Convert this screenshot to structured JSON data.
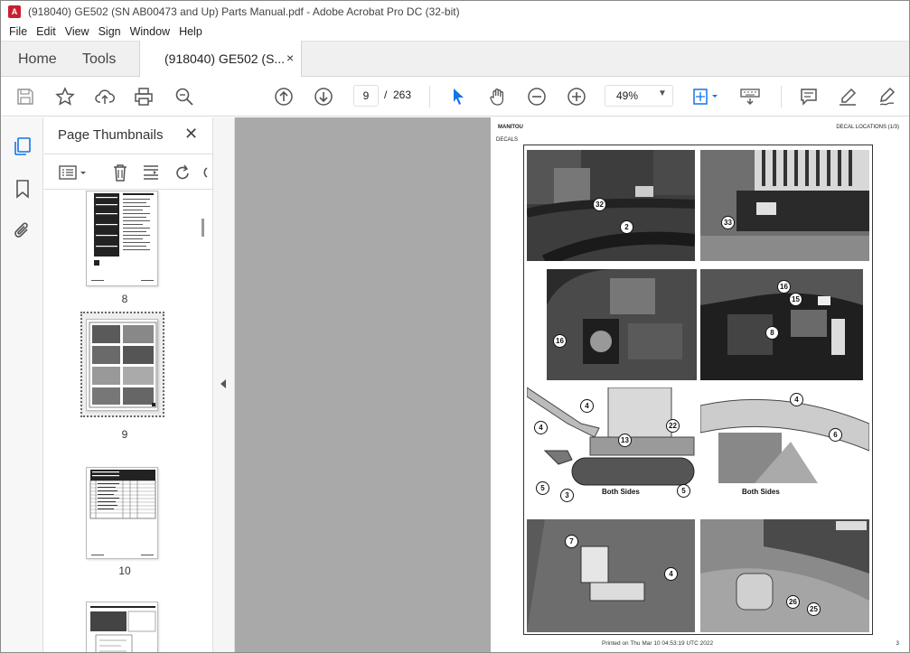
{
  "window": {
    "title": "(918040) GE502 (SN AB00473 and Up) Parts Manual.pdf - Adobe Acrobat Pro DC (32-bit)",
    "app_icon": "acrobat-icon",
    "app_icon_glyph": "A"
  },
  "menu": [
    "File",
    "Edit",
    "View",
    "Sign",
    "Window",
    "Help"
  ],
  "tabs": {
    "home": "Home",
    "tools": "Tools",
    "document": "(918040) GE502 (S...",
    "close": "×"
  },
  "toolbar": {
    "current_page": "9",
    "page_sep": "/",
    "total_pages": "263",
    "zoom": "49%",
    "zoom_caret": "▼"
  },
  "thumbnail_panel": {
    "title": "Page Thumbnails",
    "close": "✕",
    "pages": [
      "8",
      "9",
      "10"
    ],
    "selected_page": "9"
  },
  "document_page": {
    "header_left": "MANITOU",
    "header_right": "DECAL LOCATIONS (1/3)",
    "section": "DECALS",
    "footer": "Printed on  Thu Mar 10 04:53:19 UTC 2022",
    "page_number": "3",
    "both_sides_1": "Both Sides",
    "both_sides_2": "Both Sides",
    "callouts": [
      "32",
      "2",
      "33",
      "16",
      "16",
      "15",
      "8",
      "4",
      "4",
      "22",
      "13",
      "5",
      "3",
      "5",
      "4",
      "6",
      "7",
      "4",
      "26",
      "25"
    ]
  },
  "colors": {
    "accent": "#1473e6",
    "acrobat_red": "#c8202f"
  }
}
